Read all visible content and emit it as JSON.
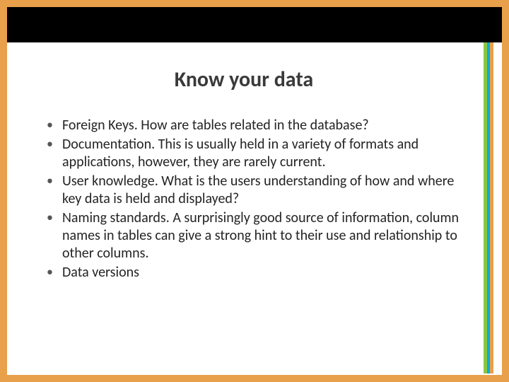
{
  "slide": {
    "title": "Know your data",
    "bullets": [
      "Foreign Keys.  How are tables related in the database?",
      "Documentation.  This is usually held in a variety of formats and applications, however, they are rarely current.",
      "User knowledge.  What is the users understanding of how and where key data is held and displayed?",
      "Naming standards.  A surprisingly good source of information, column names in tables can give a strong hint to their use and relationship to other columns.",
      "Data versions"
    ]
  }
}
